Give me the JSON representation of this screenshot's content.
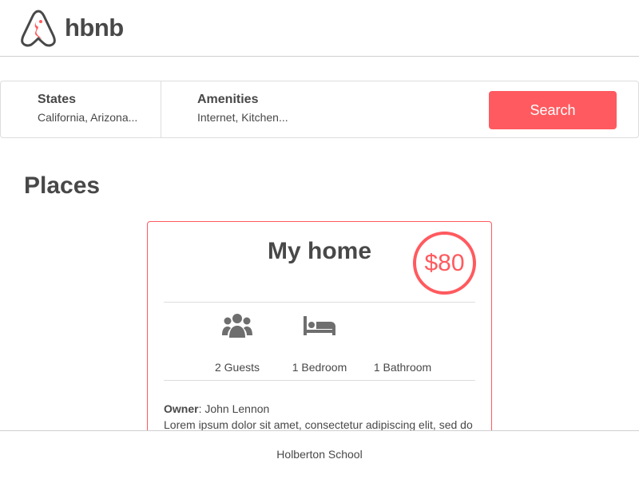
{
  "header": {
    "logo_text": "hbnb",
    "logo_icon": "hbnb-logo-icon"
  },
  "filters": {
    "states": {
      "title": "States",
      "value": "California, Arizona..."
    },
    "amenities": {
      "title": "Amenities",
      "value": "Internet, Kitchen..."
    },
    "search_label": "Search"
  },
  "places": {
    "title": "Places",
    "items": [
      {
        "name": "My home",
        "price": "$80",
        "guests": "2 Guests",
        "bedrooms": "1 Bedroom",
        "bathrooms": "1 Bathroom",
        "owner_label": "Owner",
        "owner_name": ": John Lennon",
        "description": "Lorem ipsum dolor sit amet, consectetur adipiscing elit, sed do"
      }
    ]
  },
  "footer": {
    "text": "Holberton School"
  },
  "colors": {
    "accent": "#ff5a5f",
    "text": "#484848",
    "border": "#dddddd",
    "icon": "#6e6e6e"
  }
}
